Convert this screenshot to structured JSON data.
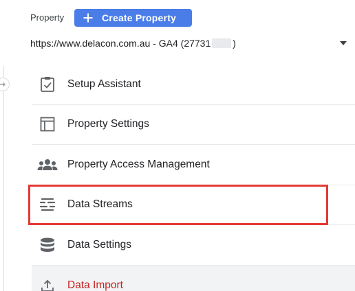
{
  "header": {
    "property_label": "Property",
    "create_button_label": "Create Property",
    "property_selector_prefix": "https://www.delacon.com.au - GA4 (27731",
    "property_selector_suffix": ")"
  },
  "menu": {
    "items": [
      {
        "label": "Setup Assistant",
        "icon": "checklist-icon"
      },
      {
        "label": "Property Settings",
        "icon": "layout-icon"
      },
      {
        "label": "Property Access Management",
        "icon": "people-icon"
      },
      {
        "label": "Data Streams",
        "icon": "streams-icon"
      },
      {
        "label": "Data Settings",
        "icon": "database-icon"
      },
      {
        "label": "Data Import",
        "icon": "upload-icon"
      }
    ]
  },
  "colors": {
    "primary_button": "#4a7de8",
    "highlight_border": "#e53935",
    "data_import_text": "#c5221f"
  }
}
